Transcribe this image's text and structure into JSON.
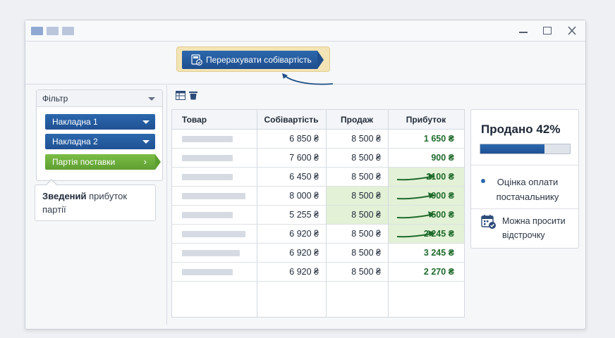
{
  "toolbar": {
    "recalc_label": "Перерахувати собівартість"
  },
  "filter": {
    "title": "Фільтр",
    "dropdowns": [
      "Накладна 1",
      "Накладна 2"
    ],
    "batch_label": "Партія поставки",
    "batch_chevron": "›"
  },
  "callout": {
    "bold": "Зведений",
    "rest": " прибуток партії"
  },
  "table": {
    "headers": [
      "Товар",
      "Собівартість",
      "Продаж",
      "Прибуток"
    ],
    "rows": [
      {
        "cost": "6 850 ₴",
        "sale": "8 500 ₴",
        "profit": "1 650 ₴",
        "highlight_sale": false,
        "highlight_profit": false,
        "arrow": false
      },
      {
        "cost": "7 600 ₴",
        "sale": "8 500 ₴",
        "profit": "900 ₴",
        "highlight_sale": false,
        "highlight_profit": false,
        "arrow": false
      },
      {
        "cost": "6 450 ₴",
        "sale": "8 500 ₴",
        "profit": "2100 ₴",
        "highlight_sale": false,
        "highlight_profit": true,
        "arrow": true
      },
      {
        "cost": "8 000 ₴",
        "sale": "8 500 ₴",
        "profit": "900 ₴",
        "highlight_sale": true,
        "highlight_profit": true,
        "arrow": true
      },
      {
        "cost": "5 255 ₴",
        "sale": "8 500 ₴",
        "profit": "500 ₴",
        "highlight_sale": true,
        "highlight_profit": true,
        "arrow": true
      },
      {
        "cost": "6 920 ₴",
        "sale": "8 500 ₴",
        "profit": "2 245 ₴",
        "highlight_sale": false,
        "highlight_profit": true,
        "arrow": true
      },
      {
        "cost": "6 920 ₴",
        "sale": "8 500 ₴",
        "profit": "3 245 ₴",
        "highlight_sale": false,
        "highlight_profit": false,
        "arrow": false
      },
      {
        "cost": "6 920 ₴",
        "sale": "8 500 ₴",
        "profit": "2 270 ₴",
        "highlight_sale": false,
        "highlight_profit": false,
        "arrow": false
      }
    ]
  },
  "summary": {
    "sold_label": "Продано",
    "sold_percent": "42%",
    "sold_fraction": 0.72,
    "note_payment": "Оцінка оплати постачальнику",
    "note_deferral": "Можна просити відстрочку"
  },
  "colors": {
    "primary": "#1f5294",
    "accent_green": "#5e9f32",
    "profit_text": "#1f6b2c",
    "highlight": "#e3f1d7"
  },
  "icons": {
    "recalc": "calculator-refresh-icon",
    "window_controls": [
      "minimize-icon",
      "maximize-icon",
      "close-icon"
    ],
    "grid_tools": [
      "table-icon",
      "trash-icon"
    ],
    "deferral": "calendar-check-icon"
  }
}
